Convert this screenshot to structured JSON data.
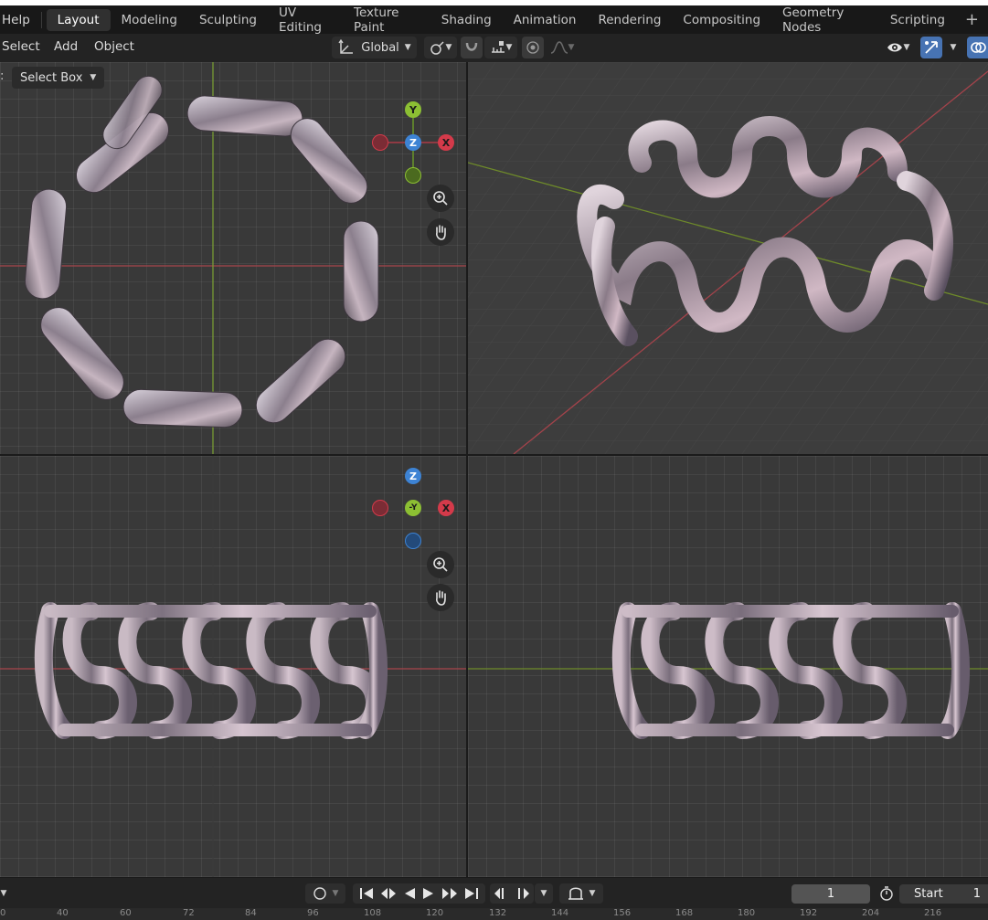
{
  "menubar": {
    "help": "Help",
    "tabs": [
      "Layout",
      "Modeling",
      "Sculpting",
      "UV Editing",
      "Texture Paint",
      "Shading",
      "Animation",
      "Rendering",
      "Compositing",
      "Geometry Nodes",
      "Scripting"
    ],
    "active_tab": "Layout",
    "add_tab": "+"
  },
  "header": {
    "select": "Select",
    "add": "Add",
    "object": "Object",
    "transform_orientation": "Global"
  },
  "tool": {
    "label": "Select Box",
    "prefix": ":"
  },
  "gizmo": {
    "top": {
      "y": "Y",
      "z": "Z",
      "x": "X"
    },
    "front": {
      "z": "Z",
      "y": "-Y",
      "x": "X"
    }
  },
  "timeline": {
    "current_frame": "1",
    "start_label": "Start",
    "start_value": "1"
  },
  "ruler_ticks": [
    "0",
    "40",
    "60",
    "72",
    "84",
    "96",
    "108",
    "120",
    "132",
    "144",
    "156",
    "168",
    "180",
    "192",
    "204",
    "216"
  ],
  "colors": {
    "accent": "#4773b3",
    "axis_x": "#d43a4a",
    "axis_y": "#86b13a",
    "axis_z": "#3d83d4"
  }
}
